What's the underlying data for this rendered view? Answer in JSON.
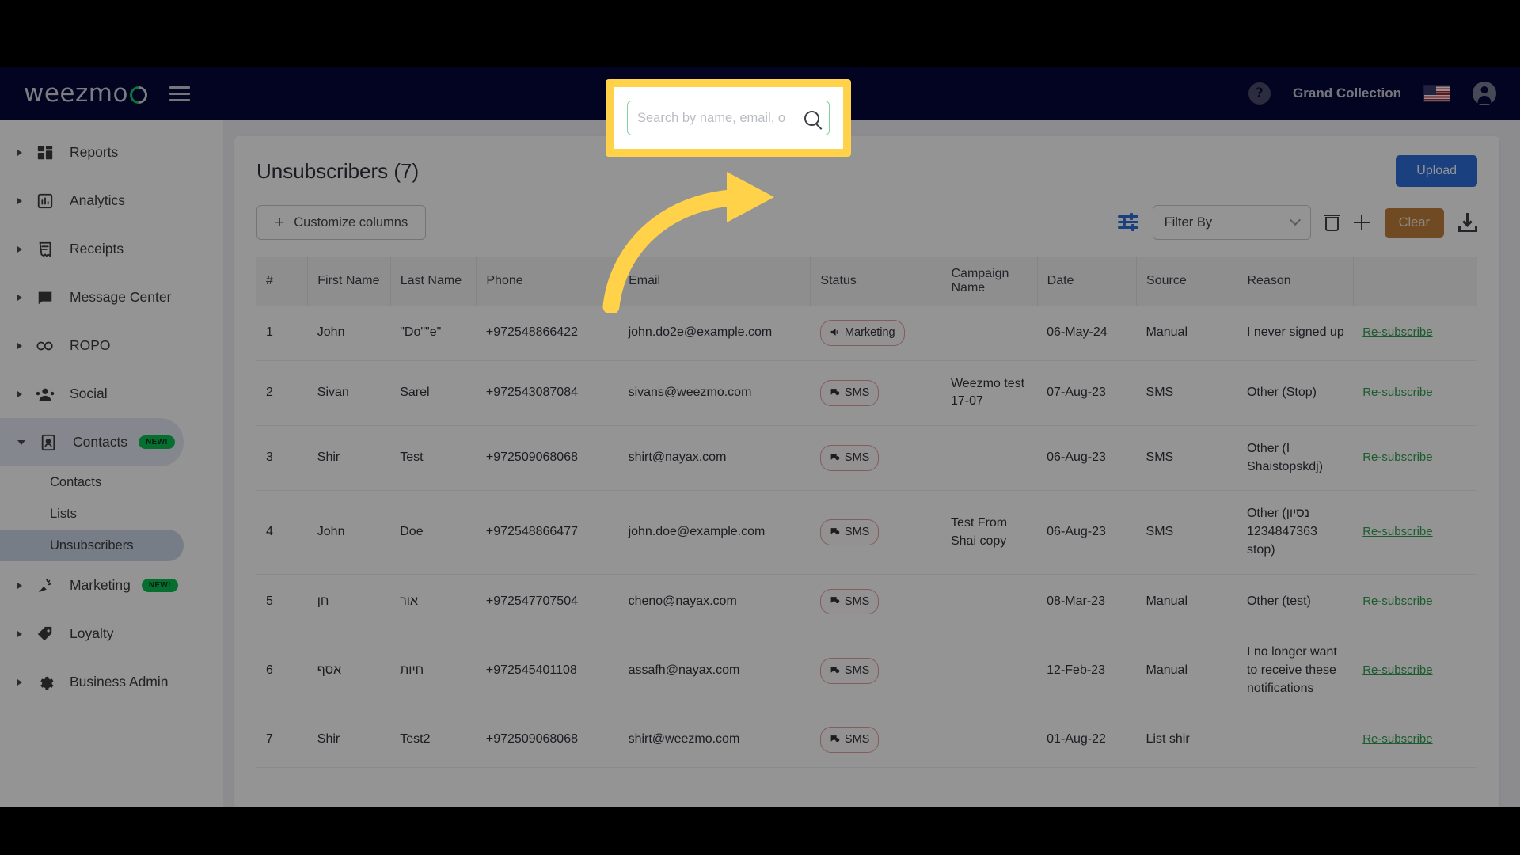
{
  "header": {
    "logo_text": "weezmo",
    "menu_icon": "hamburger-icon",
    "help_icon": "?",
    "org_name": "Grand Collection",
    "flag": "us-flag",
    "avatar": "account-icon"
  },
  "sidebar": {
    "items": [
      {
        "label": "Reports",
        "icon": "dashboard-icon",
        "badge": "",
        "expanded": false
      },
      {
        "label": "Analytics",
        "icon": "bar-chart-icon",
        "badge": "",
        "expanded": false
      },
      {
        "label": "Receipts",
        "icon": "receipt-icon",
        "badge": "",
        "expanded": false
      },
      {
        "label": "Message Center",
        "icon": "message-icon",
        "badge": "",
        "expanded": false
      },
      {
        "label": "ROPO",
        "icon": "infinity-icon",
        "badge": "",
        "expanded": false
      },
      {
        "label": "Social",
        "icon": "people-icon",
        "badge": "",
        "expanded": false
      },
      {
        "label": "Contacts",
        "icon": "contact-card-icon",
        "badge": "NEW!",
        "expanded": true
      },
      {
        "label": "Marketing",
        "icon": "megaphone-icon",
        "badge": "NEW!",
        "expanded": false
      },
      {
        "label": "Loyalty",
        "icon": "tag-icon",
        "badge": "",
        "expanded": false
      },
      {
        "label": "Business Admin",
        "icon": "gear-icon",
        "badge": "",
        "expanded": false
      }
    ],
    "contacts_subitems": [
      {
        "label": "Contacts",
        "active": false
      },
      {
        "label": "Lists",
        "active": false
      },
      {
        "label": "Unsubscribers",
        "active": true
      }
    ]
  },
  "page": {
    "title": "Unsubscribers (7)",
    "upload_label": "Upload",
    "customize_columns_label": "Customize columns",
    "filter_by_label": "Filter By",
    "clear_label": "Clear"
  },
  "search": {
    "placeholder": "Search by name, email, o",
    "value": "",
    "icon": "search-icon",
    "highlighted": true
  },
  "toolbar_icons": [
    {
      "name": "sliders-icon"
    },
    {
      "name": "trash-icon"
    },
    {
      "name": "plus-icon"
    },
    {
      "name": "download-icon"
    }
  ],
  "table": {
    "columns": [
      "#",
      "First Name",
      "Last Name",
      "Phone",
      "Email",
      "Status",
      "Campaign Name",
      "Date",
      "Source",
      "Reason",
      ""
    ],
    "action_label": "Re-subscribe",
    "rows": [
      {
        "num": "1",
        "first": "John",
        "last": "\"Do\"\"e\"",
        "phone": "+972548866422",
        "email": "john.do2e@example.com",
        "status": "Marketing",
        "status_icon": "megaphone-icon",
        "campaign": "",
        "date": "06-May-24",
        "source": "Manual",
        "reason": "I never signed up",
        "action": "Re-subscribe"
      },
      {
        "num": "2",
        "first": "Sivan",
        "last": "Sarel",
        "phone": "+972543087084",
        "email": "sivans@weezmo.com",
        "status": "SMS",
        "status_icon": "sms-icon",
        "campaign": "Weezmo test 17-07",
        "date": "07-Aug-23",
        "source": "SMS",
        "reason": "Other (Stop)",
        "action": "Re-subscribe"
      },
      {
        "num": "3",
        "first": "Shir",
        "last": "Test",
        "phone": "+972509068068",
        "email": "shirt@nayax.com",
        "status": "SMS",
        "status_icon": "sms-icon",
        "campaign": "",
        "date": "06-Aug-23",
        "source": "SMS",
        "reason": "Other (I Shaistopskdj)",
        "action": "Re-subscribe"
      },
      {
        "num": "4",
        "first": "John",
        "last": "Doe",
        "phone": "+972548866477",
        "email": "john.doe@example.com",
        "status": "SMS",
        "status_icon": "sms-icon",
        "campaign": "Test From Shai copy",
        "date": "06-Aug-23",
        "source": "SMS",
        "reason": "Other (נסיון 1234847363 stop)",
        "action": "Re-subscribe"
      },
      {
        "num": "5",
        "first": "חן",
        "last": "אור",
        "phone": "+972547707504",
        "email": "cheno@nayax.com",
        "status": "SMS",
        "status_icon": "sms-icon",
        "campaign": "",
        "date": "08-Mar-23",
        "source": "Manual",
        "reason": "Other (test)",
        "action": "Re-subscribe"
      },
      {
        "num": "6",
        "first": "אסף",
        "last": "חיות",
        "phone": "+972545401108",
        "email": "assafh@nayax.com",
        "status": "SMS",
        "status_icon": "sms-icon",
        "campaign": "",
        "date": "12-Feb-23",
        "source": "Manual",
        "reason": "I no longer want to receive these notifications",
        "action": "Re-subscribe"
      },
      {
        "num": "7",
        "first": "Shir",
        "last": "Test2",
        "phone": "+972509068068",
        "email": "shirt@weezmo.com",
        "status": "SMS",
        "status_icon": "sms-icon",
        "campaign": "",
        "date": "01-Aug-22",
        "source": "List shir",
        "reason": "",
        "action": "Re-subscribe"
      }
    ]
  },
  "annotation": {
    "arrow_color": "#FFD24A",
    "highlight_color": "#FFD24A"
  },
  "colors": {
    "header_bg": "#04073A",
    "accent_blue": "#2F6FDB",
    "new_badge": "#0BBF52",
    "clear_button": "#C0803C",
    "link_green": "#2F9E4F"
  }
}
